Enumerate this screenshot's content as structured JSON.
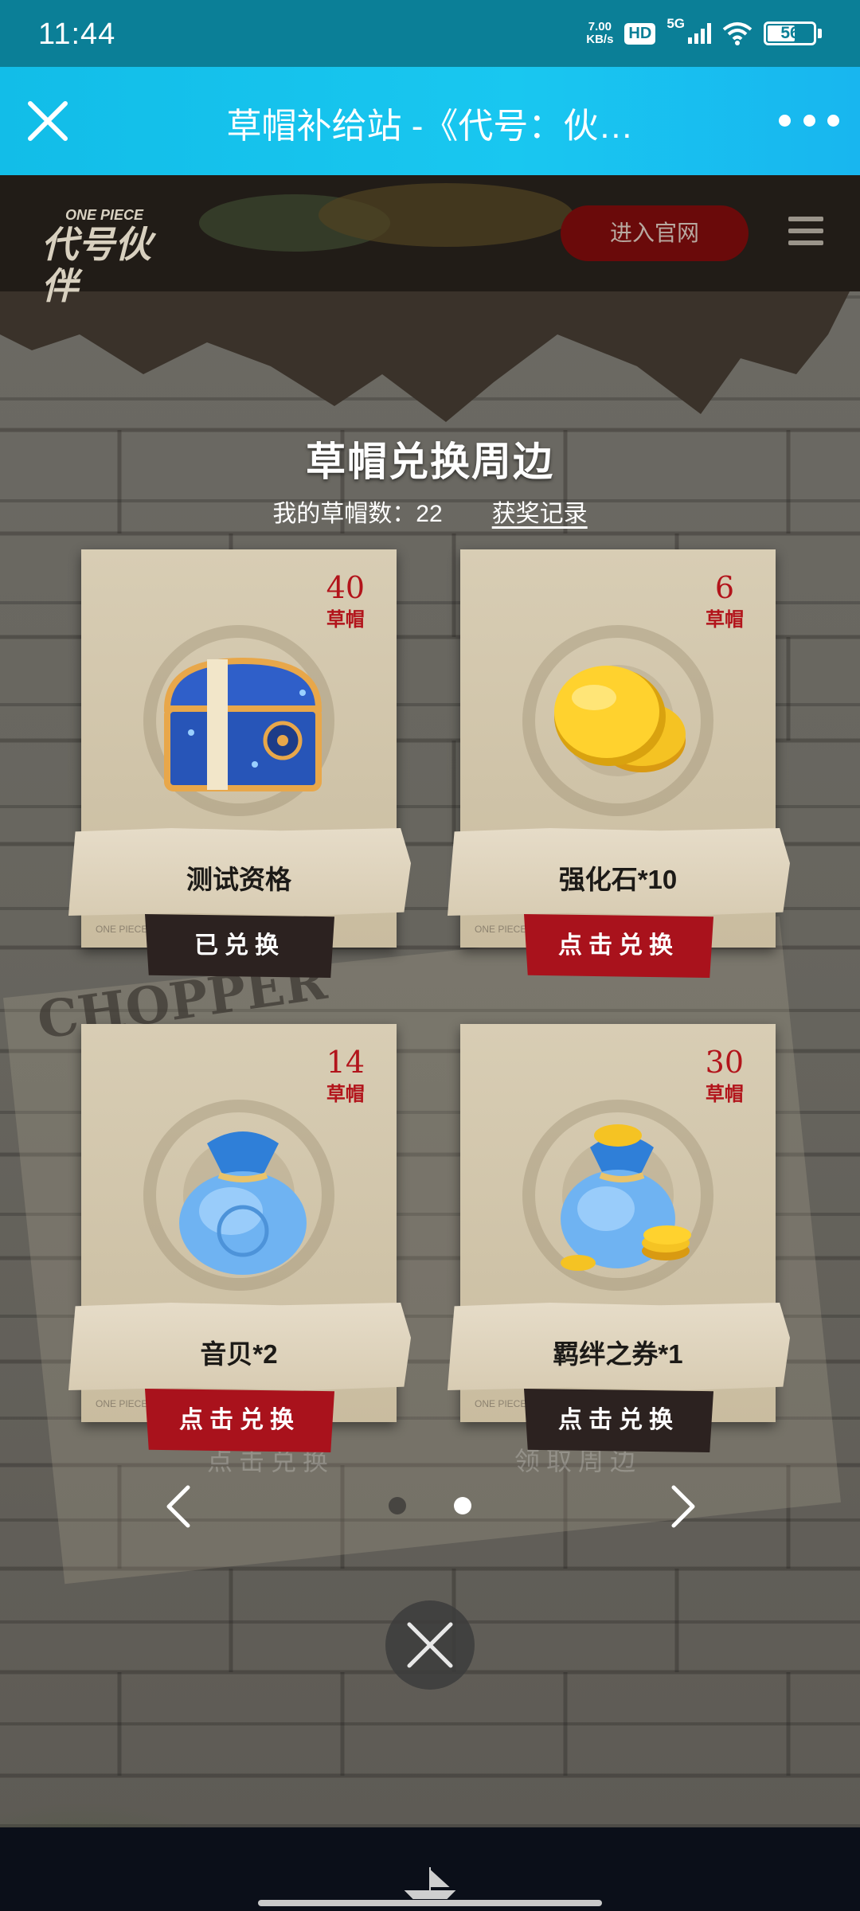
{
  "status_bar": {
    "time": "11:44",
    "net_speed_value": "7.00",
    "net_speed_unit": "KB/s",
    "hd_badge": "HD",
    "signal_label": "5G",
    "battery": "56"
  },
  "title_bar": {
    "title": "草帽补给站 -《代号：伙…"
  },
  "header": {
    "logo_top": "ONE PIECE",
    "logo_main": "代号伙伴",
    "official_button": "进入官网"
  },
  "page": {
    "section_title": "草帽兑换周边",
    "hat_count_label": "我的草帽数：22",
    "records_link": "获奖记录",
    "background_text": "CHOPPER",
    "ghost_left": "点击兑换",
    "ghost_right": "领取周边"
  },
  "items": [
    {
      "price": "40",
      "unit": "草帽",
      "name": "测试资格",
      "action": "已兑换",
      "mark": "ONE PIECE"
    },
    {
      "price": "6",
      "unit": "草帽",
      "name": "强化石*10",
      "action": "点击兑换",
      "mark": "ONE PIECE"
    },
    {
      "price": "14",
      "unit": "草帽",
      "name": "音贝*2",
      "action": "点击兑换",
      "mark": "ONE PIECE"
    },
    {
      "price": "30",
      "unit": "草帽",
      "name": "羁绊之券*1",
      "action": "点击兑换",
      "mark": "ONE PIECE"
    }
  ],
  "pager": {
    "current_page": 2,
    "total_pages": 2
  },
  "colors": {
    "title_bar": "#19c7f0",
    "status_bar": "#0b7f97",
    "price_red": "#b2141b",
    "button_red": "#a9121c",
    "button_dark": "#2c2220"
  }
}
